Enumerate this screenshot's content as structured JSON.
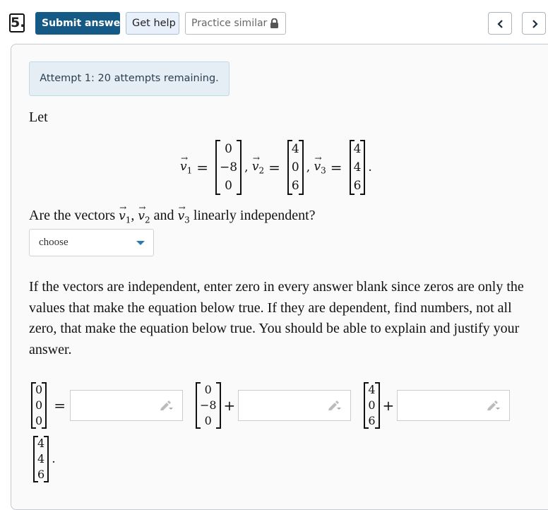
{
  "toolbar": {
    "question_number": "5.",
    "submit_label": "Submit answer",
    "help_label": "Get help",
    "practice_label": "Practice similar",
    "practice_icon": "lock-icon",
    "prev_icon": "chevron-left-icon",
    "next_icon": "chevron-right-icon"
  },
  "attempt": {
    "text": "Attempt 1: 20 attempts remaining."
  },
  "problem": {
    "intro": "Let",
    "vectors": [
      {
        "name": "v",
        "sub": "1",
        "entries": [
          "0",
          "−8",
          "0"
        ]
      },
      {
        "name": "v",
        "sub": "2",
        "entries": [
          "4",
          "0",
          "6"
        ]
      },
      {
        "name": "v",
        "sub": "3",
        "entries": [
          "4",
          "4",
          "6"
        ]
      }
    ],
    "question_parts": {
      "prefix": "Are the vectors ",
      "sep1": ", ",
      "sep2": " and ",
      "suffix": " linearly independent?"
    },
    "select": {
      "selected": "choose"
    },
    "instructions": "If the vectors are independent, enter zero in every answer blank since zeros are only the values that make the equation below true. If they are dependent, find numbers, not all zero, that make the equation below true. You should be able to explain and justify your answer.",
    "equation": {
      "lhs": [
        "0",
        "0",
        "0"
      ],
      "equals": "=",
      "plus": "+",
      "period": ".",
      "answers": [
        "",
        "",
        ""
      ]
    }
  },
  "colors": {
    "primary": "#155a86",
    "help_bg": "#e8f1fb",
    "attempt_bg": "#e6eef5",
    "caret": "#2a7ab0"
  }
}
